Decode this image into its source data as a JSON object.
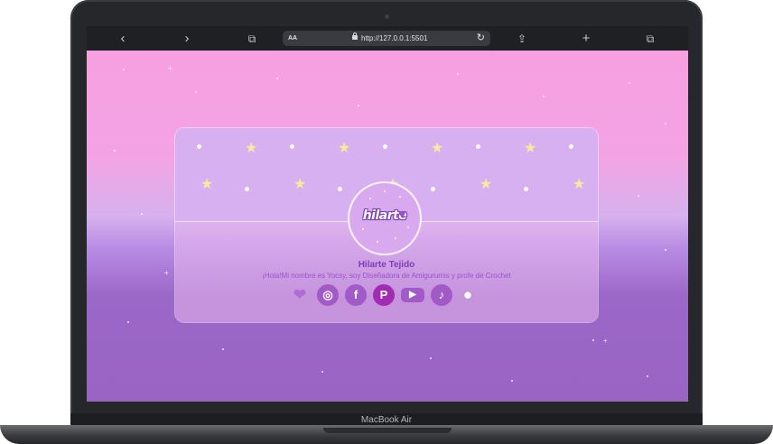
{
  "device": {
    "model_label": "MacBook Air"
  },
  "browser": {
    "back_icon": "‹",
    "forward_icon": "›",
    "reader_icon": "⧉",
    "text_size_label": "AA",
    "url": "http://127.0.0.1:5501",
    "reload_icon": "↻",
    "share_icon": "⇪",
    "new_tab_icon": "+",
    "tabs_icon": "⧉"
  },
  "profile": {
    "logo_text": "hilarte",
    "name": "Hilarte Tejido",
    "bio": "¡Hola!Mi nombre es Yocsy, soy Diseñadora de Amigurumis y profe de Crochet"
  },
  "socials": [
    {
      "name": "hilarte-logo",
      "glyph": "❤"
    },
    {
      "name": "instagram",
      "glyph": "◎"
    },
    {
      "name": "facebook",
      "glyph": "f"
    },
    {
      "name": "pinterest",
      "glyph": "P"
    },
    {
      "name": "youtube",
      "glyph": "▶"
    },
    {
      "name": "tiktok",
      "glyph": "♪"
    },
    {
      "name": "github",
      "glyph": "●"
    }
  ],
  "colors": {
    "accent": "#9b4fcf",
    "star": "#f9e99b"
  }
}
